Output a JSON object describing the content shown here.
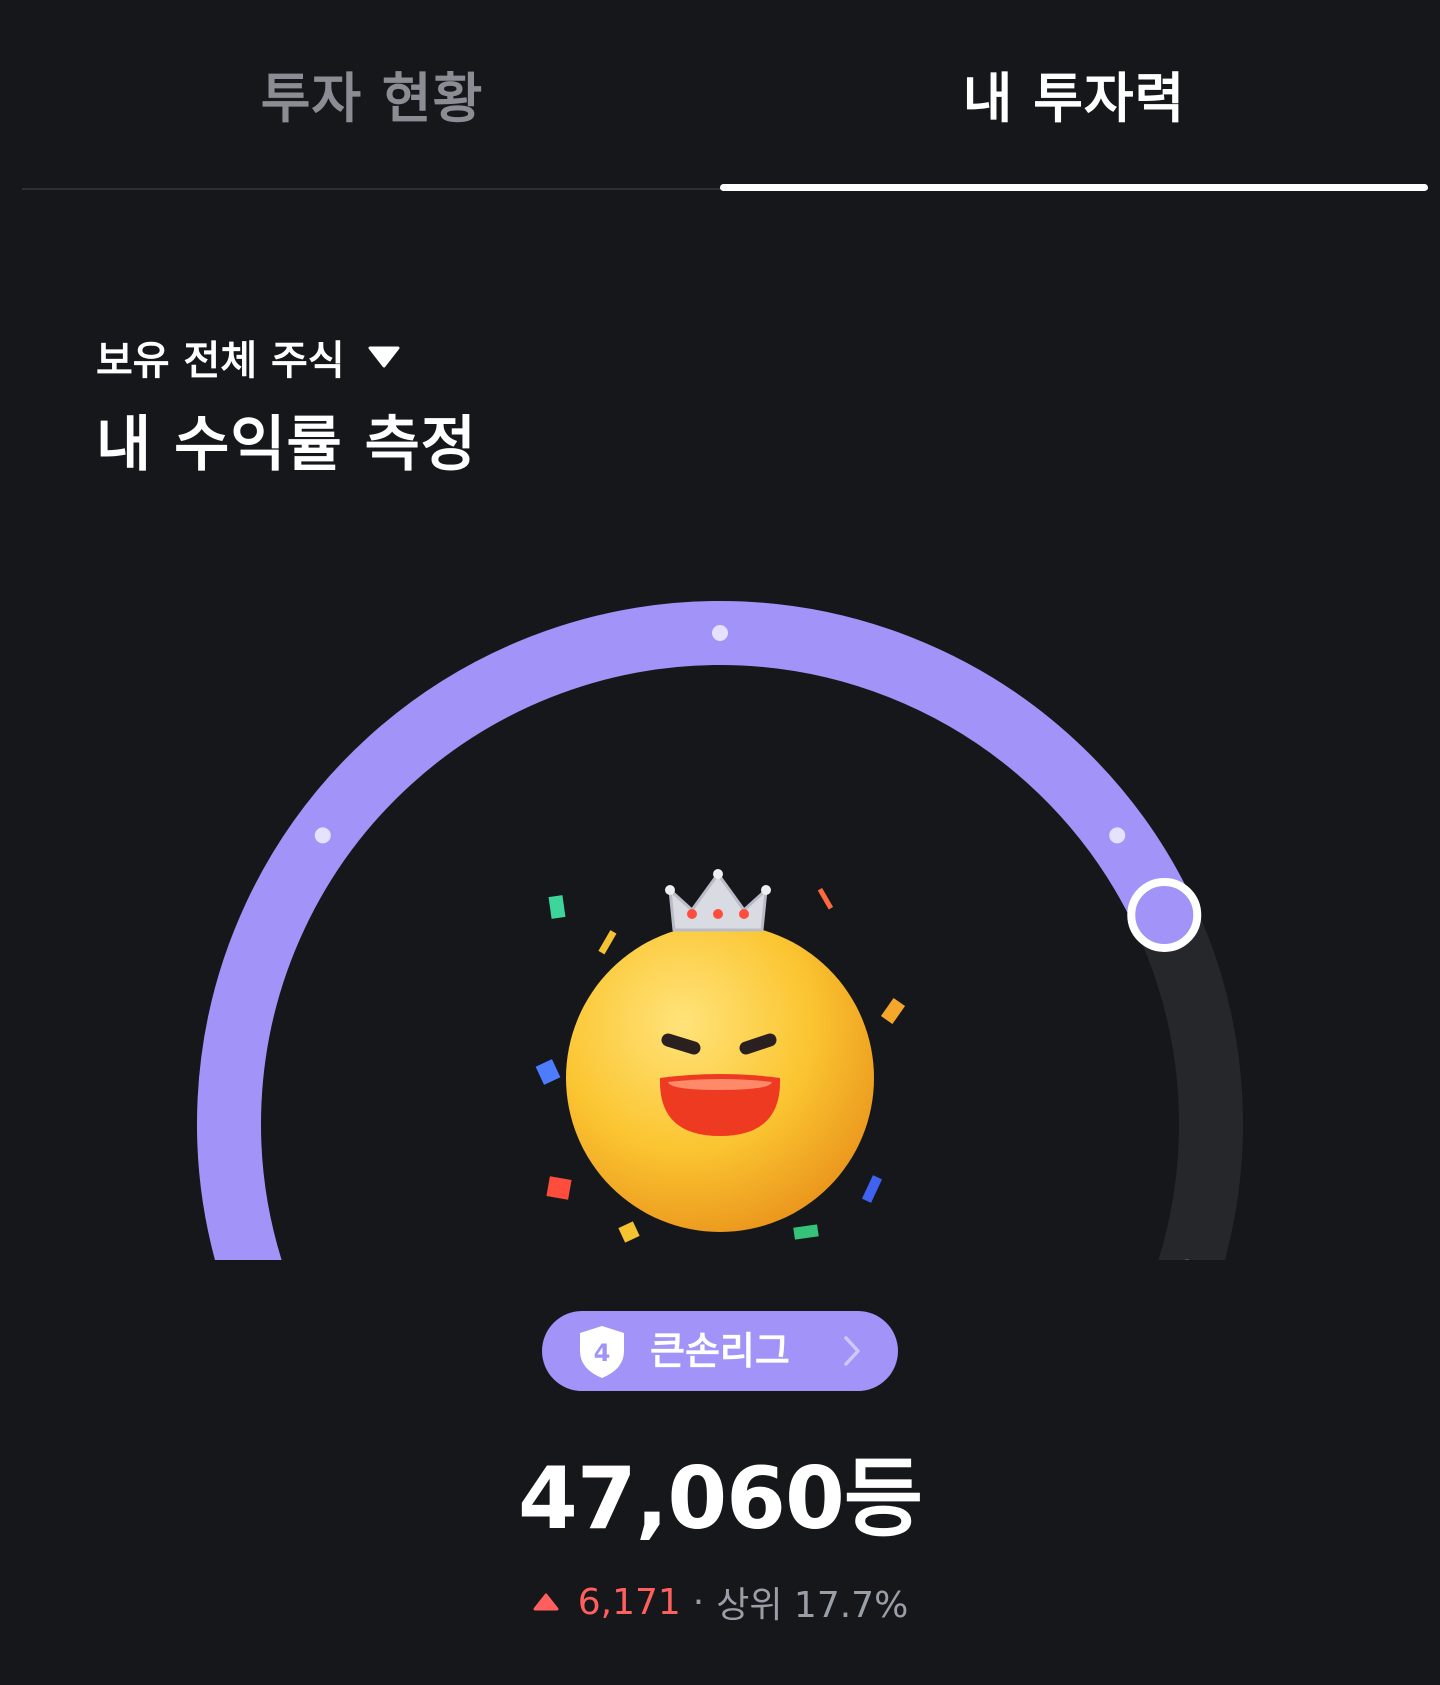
{
  "tabs": [
    {
      "label": "투자 현황",
      "active": false
    },
    {
      "label": "내 투자력",
      "active": true
    }
  ],
  "filter": {
    "label": "보유 전체 주식",
    "icon": "caret-down-icon"
  },
  "headline": "내 수익률 측정",
  "gauge": {
    "level": 0.8,
    "track_color": "#25272b",
    "fill_color": "#a293f8",
    "character": "smiling-crowned-emoji"
  },
  "league": {
    "badge_number": "4",
    "name": "큰손리그",
    "icon": "chevron-right-icon"
  },
  "rank": {
    "value": "47,060등",
    "change": "6,171",
    "change_direction": "up",
    "separator": "·",
    "percentile": "상위 17.7%"
  },
  "colors": {
    "background": "#15171b",
    "accent": "#a293f8",
    "up": "#ff5f5f",
    "muted": "#9a9ea6"
  }
}
